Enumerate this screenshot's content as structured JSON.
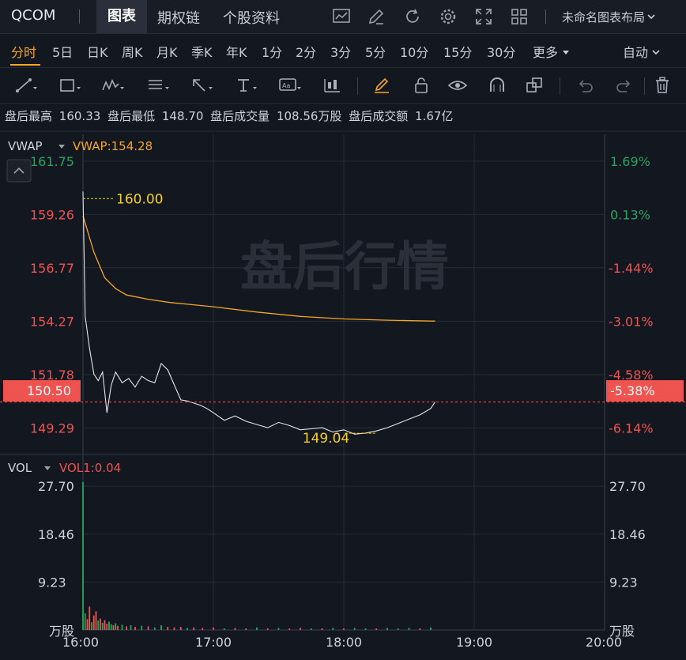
{
  "header": {
    "symbol": "QCOM",
    "tabs": [
      {
        "label": "图表",
        "active": true
      },
      {
        "label": "期权链",
        "active": false
      },
      {
        "label": "个股资料",
        "active": false
      }
    ],
    "icons": [
      "chart-type-icon",
      "pen-icon",
      "refresh-icon",
      "settings-gear-icon",
      "fullscreen-icon",
      "grid-layout-icon"
    ],
    "layout_label": "未命名图表布局",
    "layout_icon": "chevron-down-icon"
  },
  "periods": {
    "items": [
      "分时",
      "5日",
      "日K",
      "周K",
      "月K",
      "季K",
      "年K",
      "1分",
      "2分",
      "3分",
      "5分",
      "10分",
      "15分",
      "30分",
      "更多"
    ],
    "active": "分时",
    "more_icon": "caret-down-icon",
    "auto_label": "自动"
  },
  "drawing_tools": [
    "line-tool-icon",
    "rectangle-tool-icon",
    "wave-tool-icon",
    "fibonacci-tool-icon",
    "arrow-tool-icon",
    "text-tool-icon",
    "label-tool-icon",
    "candle-tool-icon",
    "brush-icon",
    "lock-icon",
    "eye-icon",
    "magnet-icon",
    "duplicate-icon",
    "undo-icon",
    "redo-icon",
    "trash-icon"
  ],
  "info": {
    "high_label": "盘后最高",
    "high": "160.33",
    "low_label": "盘后最低",
    "low": "148.70",
    "vol_label": "盘后成交量",
    "vol": "108.56万股",
    "amt_label": "盘后成交额",
    "amt": "1.67亿"
  },
  "price_panel": {
    "indicator": "VWAP",
    "indicator_value": "VWAP:154.28",
    "watermark": "盘后行情",
    "y_labels": [
      "161.75",
      "159.26",
      "156.77",
      "154.27",
      "151.78",
      "149.29"
    ],
    "pct_labels": [
      "1.69%",
      "0.13%",
      "-1.44%",
      "-3.01%",
      "-4.58%",
      "-6.14%"
    ],
    "current_price": "150.50",
    "current_pct": "-5.38%",
    "high_annot": "160.00",
    "low_annot": "149.04",
    "collapse_icon": "chevron-up-icon"
  },
  "volume_panel": {
    "indicator": "VOL",
    "indicator_value": "VOL1:0.04",
    "y_labels": [
      "27.70",
      "18.46",
      "9.23"
    ],
    "unit": "万股"
  },
  "x_labels": [
    "16:00",
    "17:00",
    "18:00",
    "19:00",
    "20:00"
  ],
  "colors": {
    "up": "#26a65b",
    "down": "#ef5350",
    "vwap": "#f5a623",
    "accent": "#f5a623",
    "price_line": "#e6e6e6"
  },
  "chart_data": {
    "type": "line",
    "x_start": "16:00",
    "x_end": "20:00",
    "price": {
      "ylim": [
        148.05,
        163.0
      ],
      "base": 160.0,
      "series": [
        {
          "name": "price",
          "x": [
            "16:00",
            "16:01",
            "16:03",
            "16:05",
            "16:07",
            "16:09",
            "16:11",
            "16:13",
            "16:15",
            "16:18",
            "16:21",
            "16:24",
            "16:27",
            "16:30",
            "16:33",
            "16:36",
            "16:39",
            "16:42",
            "16:45",
            "16:48",
            "16:51",
            "16:54",
            "16:57",
            "17:00",
            "17:05",
            "17:10",
            "17:15",
            "17:20",
            "17:25",
            "17:30",
            "17:35",
            "17:40",
            "17:45",
            "17:50",
            "17:55",
            "18:00",
            "18:05",
            "18:10",
            "18:15",
            "18:20",
            "18:25",
            "18:30",
            "18:35",
            "18:40",
            "18:42"
          ],
          "values": [
            160.33,
            154.5,
            153.0,
            151.8,
            151.5,
            151.9,
            150.0,
            151.3,
            151.9,
            151.4,
            151.6,
            151.2,
            151.7,
            151.5,
            151.4,
            152.3,
            152.0,
            151.3,
            150.6,
            150.55,
            150.45,
            150.35,
            150.2,
            150.0,
            149.65,
            149.85,
            149.6,
            149.45,
            149.3,
            149.55,
            149.4,
            149.2,
            149.25,
            149.3,
            149.1,
            149.2,
            149.0,
            149.05,
            149.15,
            149.3,
            149.5,
            149.7,
            149.9,
            150.2,
            150.5
          ]
        },
        {
          "name": "VWAP",
          "x": [
            "16:00",
            "16:05",
            "16:10",
            "16:15",
            "16:20",
            "16:30",
            "16:40",
            "16:50",
            "17:00",
            "17:20",
            "17:40",
            "18:00",
            "18:20",
            "18:40",
            "18:42"
          ],
          "values": [
            159.2,
            157.5,
            156.3,
            155.8,
            155.5,
            155.3,
            155.15,
            155.05,
            154.95,
            154.7,
            154.5,
            154.38,
            154.32,
            154.28,
            154.28
          ]
        }
      ]
    },
    "volume": {
      "ylim": [
        0,
        30
      ],
      "bars": [
        {
          "x": "16:00",
          "v": 28.5,
          "up": true
        },
        {
          "x": "16:01",
          "v": 3.2,
          "up": true
        },
        {
          "x": "16:02",
          "v": 2.1,
          "up": false
        },
        {
          "x": "16:03",
          "v": 4.5,
          "up": false
        },
        {
          "x": "16:04",
          "v": 1.5,
          "up": true
        },
        {
          "x": "16:05",
          "v": 2.8,
          "up": false
        },
        {
          "x": "16:06",
          "v": 3.6,
          "up": false
        },
        {
          "x": "16:07",
          "v": 1.8,
          "up": true
        },
        {
          "x": "16:08",
          "v": 2.2,
          "up": false
        },
        {
          "x": "16:09",
          "v": 1.4,
          "up": true
        },
        {
          "x": "16:10",
          "v": 1.9,
          "up": false
        },
        {
          "x": "16:11",
          "v": 1.2,
          "up": false
        },
        {
          "x": "16:12",
          "v": 1.6,
          "up": true
        },
        {
          "x": "16:13",
          "v": 1.1,
          "up": true
        },
        {
          "x": "16:14",
          "v": 0.9,
          "up": false
        },
        {
          "x": "16:15",
          "v": 1.3,
          "up": true
        },
        {
          "x": "16:16",
          "v": 0.8,
          "up": false
        },
        {
          "x": "16:18",
          "v": 1.0,
          "up": true
        },
        {
          "x": "16:20",
          "v": 0.7,
          "up": false
        },
        {
          "x": "16:22",
          "v": 0.9,
          "up": true
        },
        {
          "x": "16:24",
          "v": 0.6,
          "up": false
        },
        {
          "x": "16:27",
          "v": 0.8,
          "up": true
        },
        {
          "x": "16:30",
          "v": 0.7,
          "up": false
        },
        {
          "x": "16:33",
          "v": 0.5,
          "up": true
        },
        {
          "x": "16:36",
          "v": 0.9,
          "up": true
        },
        {
          "x": "16:39",
          "v": 0.6,
          "up": false
        },
        {
          "x": "16:42",
          "v": 0.5,
          "up": false
        },
        {
          "x": "16:45",
          "v": 0.6,
          "up": false
        },
        {
          "x": "16:48",
          "v": 0.4,
          "up": true
        },
        {
          "x": "16:51",
          "v": 0.5,
          "up": false
        },
        {
          "x": "16:55",
          "v": 0.4,
          "up": false
        },
        {
          "x": "17:00",
          "v": 0.5,
          "up": false
        },
        {
          "x": "17:05",
          "v": 0.3,
          "up": true
        },
        {
          "x": "17:10",
          "v": 0.4,
          "up": false
        },
        {
          "x": "17:15",
          "v": 0.3,
          "up": false
        },
        {
          "x": "17:20",
          "v": 0.5,
          "up": true
        },
        {
          "x": "17:25",
          "v": 0.3,
          "up": false
        },
        {
          "x": "17:30",
          "v": 0.4,
          "up": true
        },
        {
          "x": "17:35",
          "v": 0.3,
          "up": false
        },
        {
          "x": "17:40",
          "v": 0.4,
          "up": false
        },
        {
          "x": "17:45",
          "v": 0.3,
          "up": true
        },
        {
          "x": "17:50",
          "v": 0.3,
          "up": false
        },
        {
          "x": "17:55",
          "v": 0.4,
          "up": true
        },
        {
          "x": "18:00",
          "v": 0.3,
          "up": false
        },
        {
          "x": "18:05",
          "v": 0.4,
          "up": true
        },
        {
          "x": "18:10",
          "v": 0.3,
          "up": true
        },
        {
          "x": "18:15",
          "v": 0.3,
          "up": false
        },
        {
          "x": "18:20",
          "v": 0.4,
          "up": true
        },
        {
          "x": "18:25",
          "v": 0.3,
          "up": true
        },
        {
          "x": "18:30",
          "v": 0.4,
          "up": true
        },
        {
          "x": "18:35",
          "v": 0.3,
          "up": false
        },
        {
          "x": "18:40",
          "v": 0.5,
          "up": true
        }
      ]
    }
  }
}
